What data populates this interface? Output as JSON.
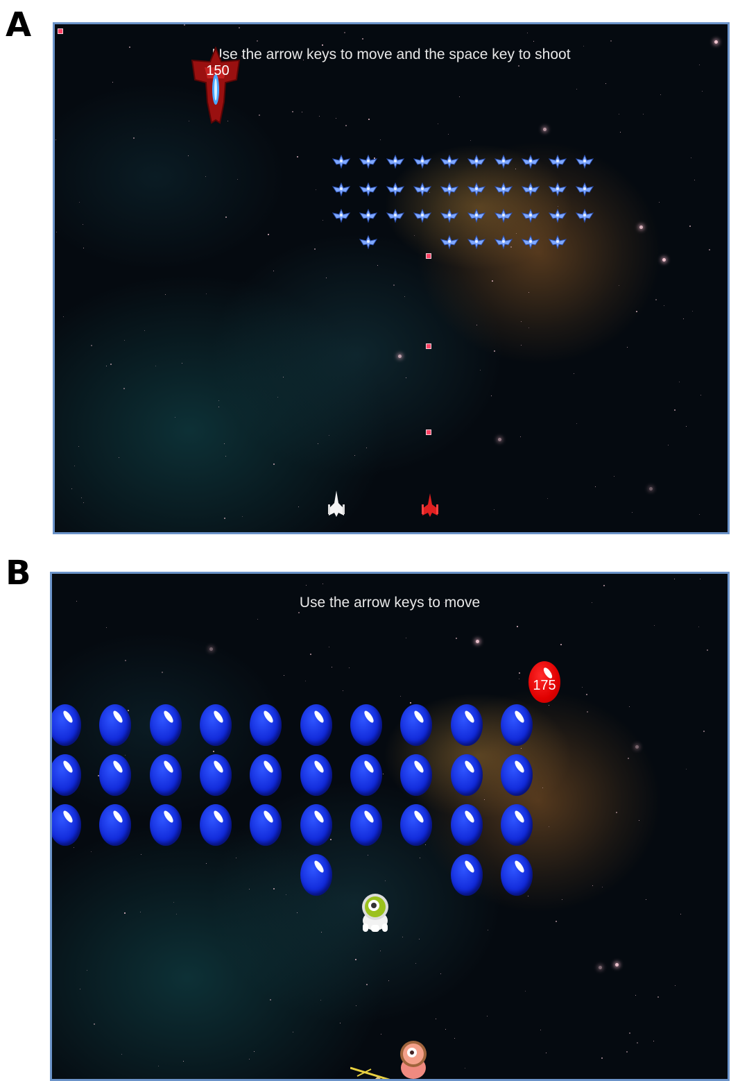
{
  "panels": [
    {
      "letter": "A",
      "instruction": "Use the arrow keys to move and the space key to shoot",
      "boss_score": "150",
      "alien_rows": [
        10,
        10,
        10,
        6
      ]
    },
    {
      "letter": "B",
      "instruction": "Use the arrow keys to move",
      "boss_score": "175",
      "egg_rows": [
        10,
        10,
        10,
        3
      ]
    }
  ],
  "colors": {
    "frame_border": "#6b93c9",
    "blue_egg": "#1028d8",
    "red_egg": "#e00000",
    "player_a1": "#ffffff",
    "player_a2": "#e02020"
  },
  "icons": [
    "boss-ship-icon",
    "alien-fighter-icon",
    "player-ship-icon",
    "blue-egg-icon",
    "red-egg-icon",
    "astronaut-icon",
    "slingshot-icon"
  ]
}
